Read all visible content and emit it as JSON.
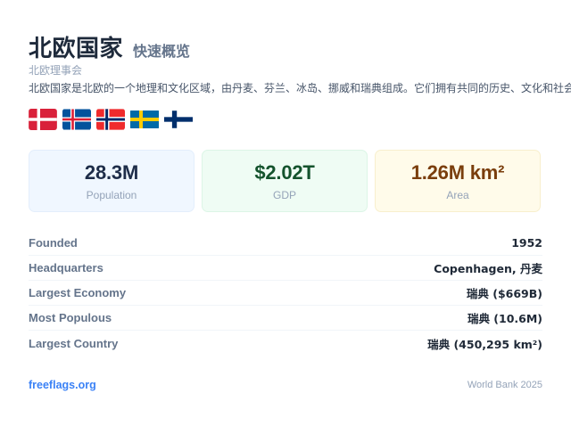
{
  "header": {
    "title": "北欧国家",
    "subtitle": "快速概览",
    "organization": "北欧理事会",
    "description": "北欧国家是北欧的一个地理和文化区域，由丹麦、芬兰、冰岛、挪威和瑞典组成。它们拥有共同的历史、文化和社会价值观。"
  },
  "flags": [
    {
      "name": "denmark",
      "icon": "denmark-flag-icon"
    },
    {
      "name": "iceland",
      "icon": "iceland-flag-icon"
    },
    {
      "name": "norway",
      "icon": "norway-flag-icon"
    },
    {
      "name": "sweden",
      "icon": "sweden-flag-icon"
    },
    {
      "name": "finland",
      "icon": "finland-flag-icon"
    }
  ],
  "stats": [
    {
      "value": "28.3M",
      "label": "Population",
      "color": "#1e2d49"
    },
    {
      "value": "$2.02T",
      "label": "GDP",
      "color": "#14532d"
    },
    {
      "value": "1.26M km²",
      "label": "Area",
      "color": "#7a3e0c"
    }
  ],
  "facts": [
    {
      "key": "Founded",
      "value": "1952"
    },
    {
      "key": "Headquarters",
      "value": "Copenhagen, 丹麦"
    },
    {
      "key": "Largest Economy",
      "value": "瑞典 ($669B)"
    },
    {
      "key": "Most Populous",
      "value": "瑞典 (10.6M)"
    },
    {
      "key": "Largest Country",
      "value": "瑞典 (450,295 km²)"
    }
  ],
  "footer": {
    "link": "freeflags.org",
    "source": "World Bank 2025"
  },
  "colors": {
    "accent": "#3b82f6",
    "title": "#1e2a3b"
  }
}
